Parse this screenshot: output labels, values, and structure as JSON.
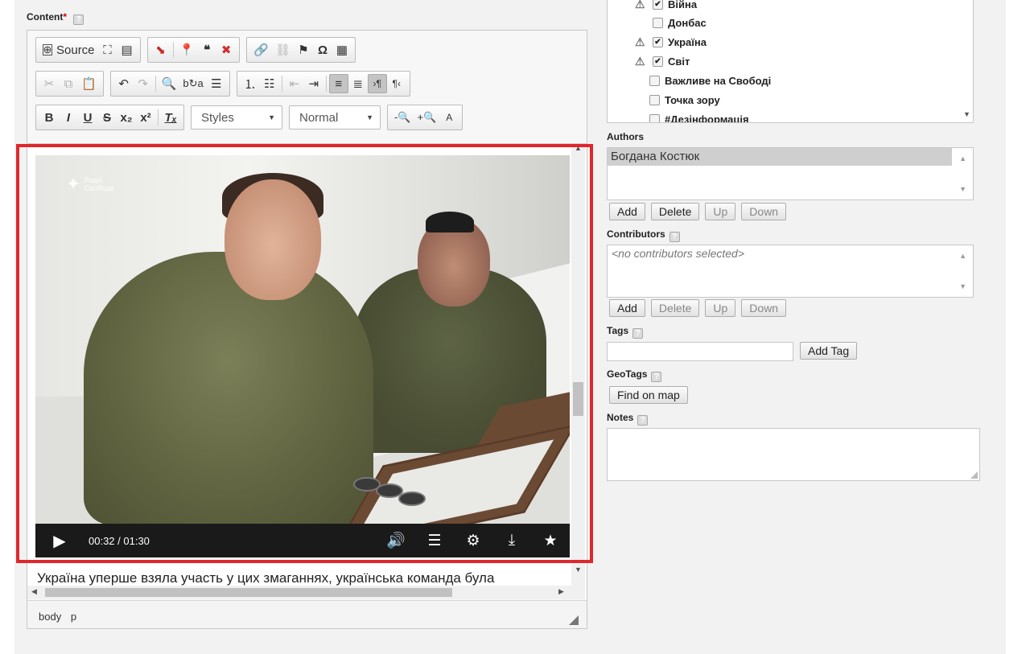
{
  "content_label": "Content",
  "required_mark": "*",
  "help_glyph": "?",
  "toolbar": {
    "source_label": "Source",
    "styles_label": "Styles",
    "format_label": "Normal"
  },
  "video": {
    "logo_line1": "Радіо",
    "logo_line2": "Свобода",
    "time": "00:32 / 01:30"
  },
  "body_text": "Україна уперше взяла участь у цих змаганнях, українська команда була",
  "element_path": [
    "body",
    "p"
  ],
  "categories": [
    {
      "label": "Війна",
      "checked": true,
      "warning": true
    },
    {
      "label": "Донбас",
      "checked": false,
      "warning": false
    },
    {
      "label": "Україна",
      "checked": true,
      "warning": true
    },
    {
      "label": "Світ",
      "checked": true,
      "warning": true
    },
    {
      "label": "Важливе на Свободі",
      "checked": false,
      "warning": false
    },
    {
      "label": "Точка зору",
      "checked": false,
      "warning": false
    },
    {
      "label": "#Дезінформація",
      "checked": false,
      "warning": false
    }
  ],
  "authors": {
    "label": "Authors",
    "selected": "Богдана Костюк",
    "buttons": [
      "Add",
      "Delete",
      "Up",
      "Down"
    ]
  },
  "contributors": {
    "label": "Contributors",
    "placeholder": "<no contributors selected>",
    "buttons": [
      "Add",
      "Delete",
      "Up",
      "Down"
    ]
  },
  "tags": {
    "label": "Tags",
    "value": "",
    "add_button": "Add Tag"
  },
  "geotags": {
    "label": "GeoTags",
    "button": "Find on map"
  },
  "notes": {
    "label": "Notes",
    "value": ""
  },
  "colors": {
    "highlight": "#e0272c",
    "panel_bg": "#f2f2f2"
  }
}
